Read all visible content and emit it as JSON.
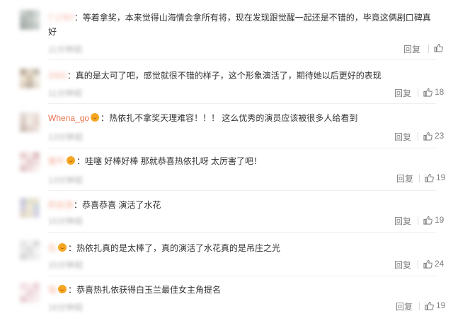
{
  "comments": [
    {
      "username": "7 1767",
      "text": "等着拿奖，本来觉得山海情会拿所有将，现在发现跟觉醒一起还是不错的，毕竟这俩剧口碑真好",
      "time": "11分钟前",
      "reply_label": "回复",
      "likes": ""
    },
    {
      "username": "2002",
      "text": "真的是太可了吧，感觉就很不错的样子，这个形象演活了，期待她以后更好的表现",
      "time": "11分钟前",
      "reply_label": "回复",
      "likes": "18"
    },
    {
      "username": "Whena_go",
      "text": "热依扎不拿奖天理难容！！！ 这么优秀的演员应该被很多人给看到",
      "time": "13分钟前",
      "reply_label": "回复",
      "likes": "23"
    },
    {
      "username": "紫叶",
      "text": "哇噻 好棒好棒 那就恭喜热依扎呀 太厉害了吧！",
      "time": "13分钟前",
      "reply_label": "回复",
      "likes": "19"
    },
    {
      "username": "的女孩",
      "text": "恭喜恭喜 演活了水花",
      "time": "15分钟前",
      "reply_label": "回复",
      "likes": "19"
    },
    {
      "username": "仇",
      "text": "热依扎真的是太棒了，真的演活了水花真的是吊庄之光",
      "time": "15分钟前",
      "reply_label": "回复",
      "likes": "24"
    },
    {
      "username": "珑",
      "text": "恭喜热扎依获得白玉兰最佳女主角提名",
      "time": "16分钟前",
      "reply_label": "回复",
      "likes": "19"
    }
  ],
  "colors": {
    "username": "#eb7350",
    "meta": "#808080",
    "text": "#333333",
    "badge": "#f5a623"
  },
  "icons": {
    "like": "thumbs-up-icon",
    "badge": "vip-badge-icon"
  }
}
